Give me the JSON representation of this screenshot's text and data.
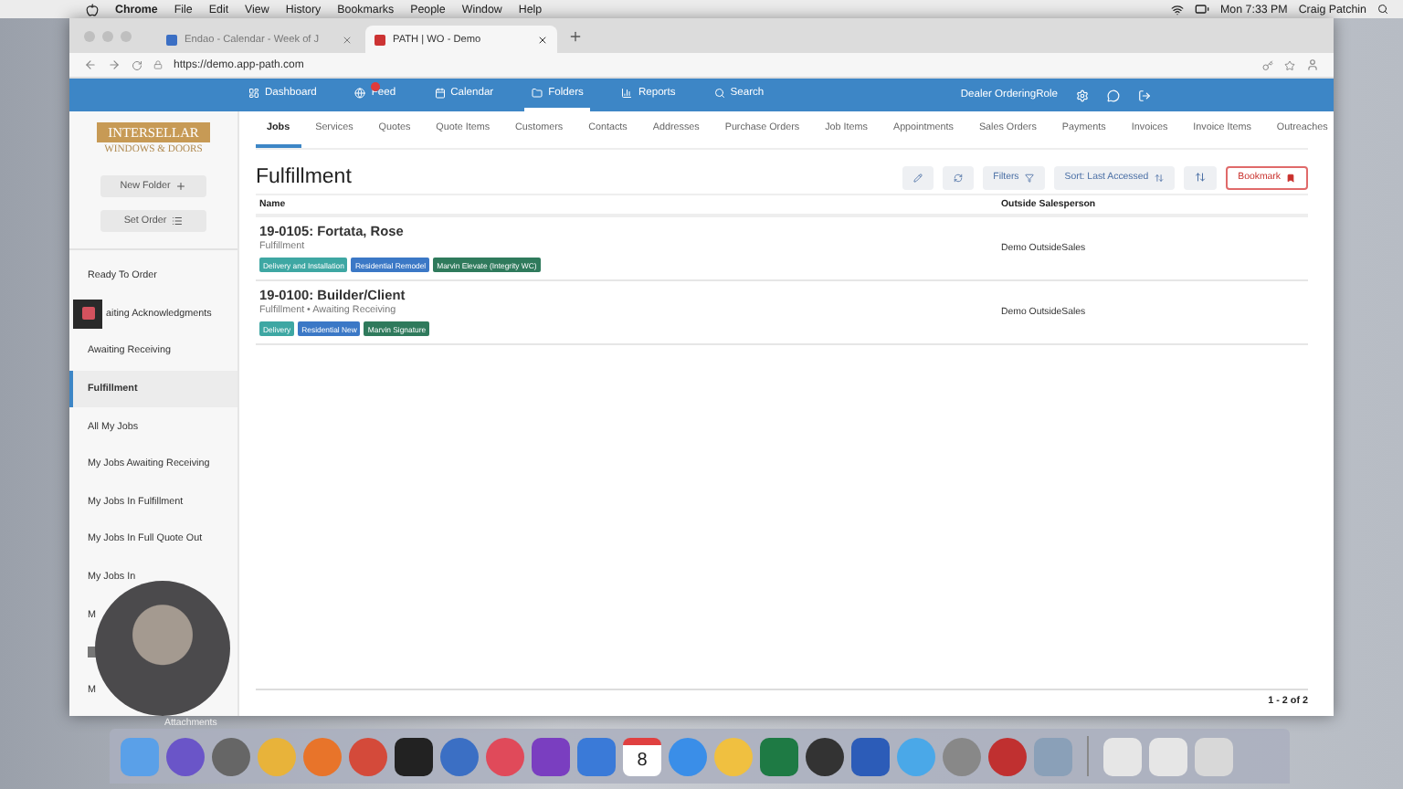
{
  "menubar": {
    "app": "Chrome",
    "menus": [
      "File",
      "Edit",
      "View",
      "History",
      "Bookmarks",
      "People",
      "Window",
      "Help"
    ],
    "clock": "Mon 7:33 PM",
    "user": "Craig Patchin"
  },
  "browser": {
    "tabs": [
      {
        "title": "Endao - Calendar - Week of J",
        "selected": false
      },
      {
        "title": "PATH | WO - Demo",
        "selected": true
      }
    ],
    "url": "https://demo.app-path.com"
  },
  "nav": {
    "items": [
      {
        "label": "Dashboard",
        "selected": false,
        "alert": false
      },
      {
        "label": "Feed",
        "selected": false,
        "alert": true
      },
      {
        "label": "Calendar",
        "selected": false,
        "alert": false
      },
      {
        "label": "Folders",
        "selected": true,
        "alert": false
      },
      {
        "label": "Reports",
        "selected": false,
        "alert": false
      },
      {
        "label": "Search",
        "selected": false,
        "alert": false
      }
    ],
    "role": "Dealer OrderingRole"
  },
  "sidebar": {
    "logo": {
      "top": "INTERSELLAR",
      "bottom": "WINDOWS & DOORS"
    },
    "buttons": [
      "New Folder",
      "Set Order"
    ],
    "items": [
      {
        "kind": "text",
        "label": "Ready To Order",
        "selected": false,
        "covered": false
      },
      {
        "kind": "text",
        "label": "aiting Acknowledgments",
        "selected": false,
        "covered": true
      },
      {
        "kind": "text",
        "label": "Awaiting Receiving",
        "selected": false,
        "covered": false
      },
      {
        "kind": "text",
        "label": "Fulfillment",
        "selected": true,
        "covered": false
      },
      {
        "kind": "text",
        "label": "All My Jobs",
        "selected": false,
        "covered": false
      },
      {
        "kind": "text",
        "label": "My Jobs Awaiting Receiving",
        "selected": false,
        "covered": false
      },
      {
        "kind": "text",
        "label": "My Jobs In Fulfillment",
        "selected": false,
        "covered": false
      },
      {
        "kind": "text",
        "label": "My Jobs In Full Quote Out",
        "selected": false,
        "covered": false
      },
      {
        "kind": "text",
        "label": "My Jobs In",
        "selected": false,
        "covered": false
      },
      {
        "kind": "text",
        "label": "M",
        "selected": false,
        "covered": false
      },
      {
        "kind": "icon",
        "selected": false,
        "covered": false
      },
      {
        "kind": "text",
        "label": "M",
        "selected": false,
        "covered": false
      }
    ]
  },
  "tabs": [
    {
      "label": "Jobs",
      "selected": true
    },
    {
      "label": "Services",
      "selected": false
    },
    {
      "label": "Quotes",
      "selected": false
    },
    {
      "label": "Quote Items",
      "selected": false
    },
    {
      "label": "Customers",
      "selected": false
    },
    {
      "label": "Contacts",
      "selected": false
    },
    {
      "label": "Addresses",
      "selected": false
    },
    {
      "label": "Purchase Orders",
      "selected": false
    },
    {
      "label": "Job Items",
      "selected": false
    },
    {
      "label": "Appointments",
      "selected": false
    },
    {
      "label": "Sales Orders",
      "selected": false
    },
    {
      "label": "Payments",
      "selected": false
    },
    {
      "label": "Invoices",
      "selected": false
    },
    {
      "label": "Invoice Items",
      "selected": false
    },
    {
      "label": "Outreaches",
      "selected": false
    }
  ],
  "page": {
    "title": "Fulfillment",
    "filters": "Filters",
    "sort": "Sort: Last Accessed",
    "bookmark": "Bookmark"
  },
  "table": {
    "columns": [
      "Name",
      "Outside Salesperson"
    ],
    "rows": [
      {
        "title": "19-0105: Fortata, Rose",
        "subtitle": "Fulfillment",
        "tags": [
          {
            "label": "Delivery and Installation",
            "color": "#3ea7a3"
          },
          {
            "label": "Residential Remodel",
            "color": "#3b78c6"
          },
          {
            "label": "Marvin Elevate (Integrity WC)",
            "color": "#2f7a5c"
          }
        ],
        "salesperson": "Demo OutsideSales"
      },
      {
        "title": "19-0100: Builder/Client",
        "subtitle": "Fulfillment • Awaiting Receiving",
        "tags": [
          {
            "label": "Delivery",
            "color": "#3ea7a3"
          },
          {
            "label": "Residential New",
            "color": "#3b78c6"
          },
          {
            "label": "Marvin Signature",
            "color": "#2f7a5c"
          }
        ],
        "salesperson": "Demo OutsideSales"
      }
    ],
    "footer": "1 - 2 of 2"
  },
  "overlay": {
    "caption": "Attachments"
  },
  "dock": {
    "calendar_day": "8"
  }
}
